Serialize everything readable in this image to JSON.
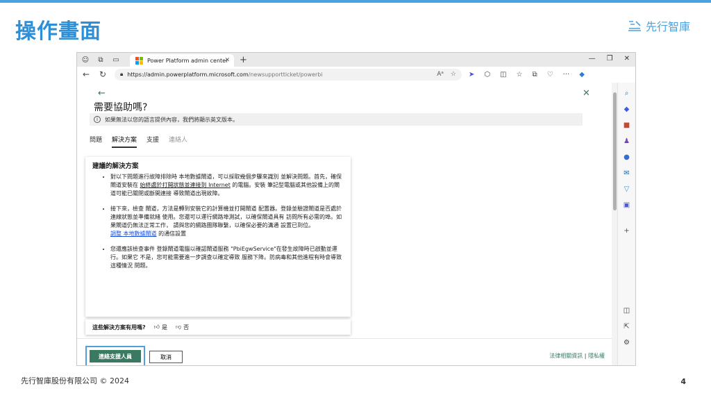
{
  "slide": {
    "title": "操作畫面",
    "brand": "先行智庫",
    "footer_left": "先行智庫股份有限公司 © 2024",
    "page_number": "4",
    "accent_color": "#4aa3df"
  },
  "browser": {
    "tab_title": "Power Platform admin center",
    "url_host": "https://admin.powerplatform.microsoft.com",
    "url_path": "/newsupportticket/powerbi"
  },
  "panel": {
    "title": "需要協助嗎?",
    "notice": "如果無法以您的語言提供內容，我們將顯示英文版本。",
    "tabs": [
      {
        "label": "問題"
      },
      {
        "label": "解決方案"
      },
      {
        "label": "支援"
      },
      {
        "label": "連絡人"
      }
    ],
    "card": {
      "heading": "建議的解決方案",
      "b1_part1": "對以下問題進行故障排除時 本地數據閘道，可以採取幾個步驟來識別 並解決問題。首先，確保閘道安裝在 ",
      "b1_link": "始終處於打開狀態並連接到 Internet",
      "b1_part2": " 的電腦。安裝 筆記型電腦或其他設備上的閘道可能已關閉或斷開連接 導致閘道出現故障。",
      "b2_text": "接下來，檢查 閘道，方法是轉到安裝它的計算機並打開閘道 配置器。登錄並驗證閘道是否處於連線狀態並準備就緒 使用。您還可以運行網路埠測試，以確保閘道具有 訪問所有必需的埠。如果閘道仍無法正常工作， 請與您的網路團隊聯繫，以確保必要的溝通 設置已到位。",
      "b2_link": "調整 本地數據閘道",
      "b2_after": " 的通信設置",
      "b3_text": "您還應該檢查事件 登錄閘道電腦以確認閘道服務 \"PbiEgwService\"在發生故障時已啟動並運行。如果它 不是，您可能需要進一步調查以確定導致 服務下降。防病毒和其他進程有時會導致這種情況 問題。"
    },
    "feedback": {
      "question": "這些解決方案有用嗎?",
      "yes": "是",
      "no": "否"
    },
    "buttons": {
      "contact": "連絡支援人員",
      "cancel": "取消"
    },
    "legal": {
      "terms": "法律相關資訊",
      "separator": "|",
      "privacy": "隱私權"
    }
  }
}
